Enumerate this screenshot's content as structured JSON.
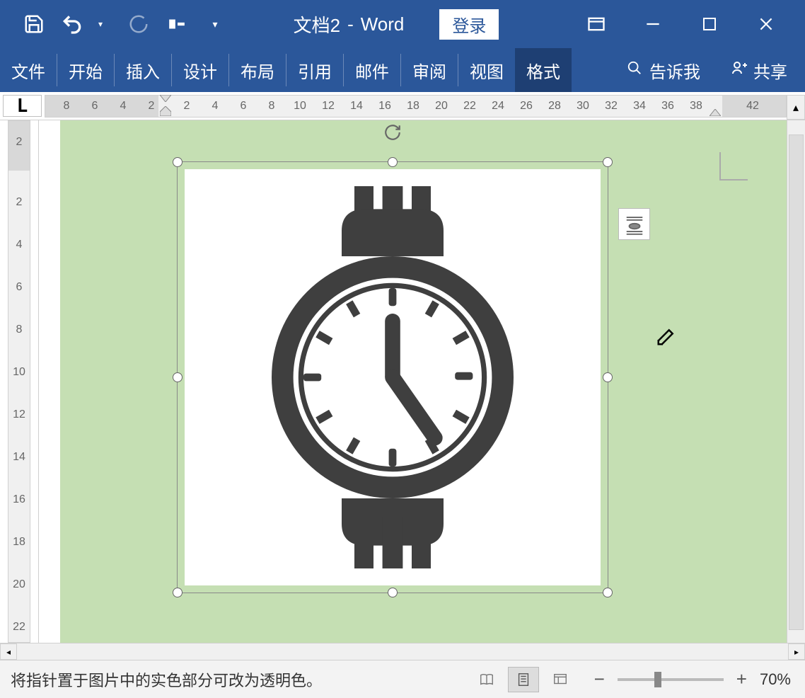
{
  "title": {
    "doc": "文档2",
    "sep": "-",
    "app": "Word"
  },
  "login": "登录",
  "tabs": {
    "file": "文件",
    "home": "开始",
    "insert": "插入",
    "design": "设计",
    "layout": "布局",
    "references": "引用",
    "mailings": "邮件",
    "review": "审阅",
    "view": "视图",
    "format": "格式"
  },
  "tell_me": "告诉我",
  "share": "共享",
  "hruler": [
    8,
    6,
    4,
    2,
    2,
    4,
    6,
    8,
    10,
    12,
    14,
    16,
    18,
    20,
    22,
    24,
    26,
    28,
    30,
    32,
    34,
    36,
    38,
    42
  ],
  "vruler": [
    2,
    2,
    4,
    6,
    8,
    10,
    12,
    14,
    16,
    18,
    20,
    22
  ],
  "status_text": "将指针置于图片中的实色部分可改为透明色。",
  "zoom_pct": "70%"
}
